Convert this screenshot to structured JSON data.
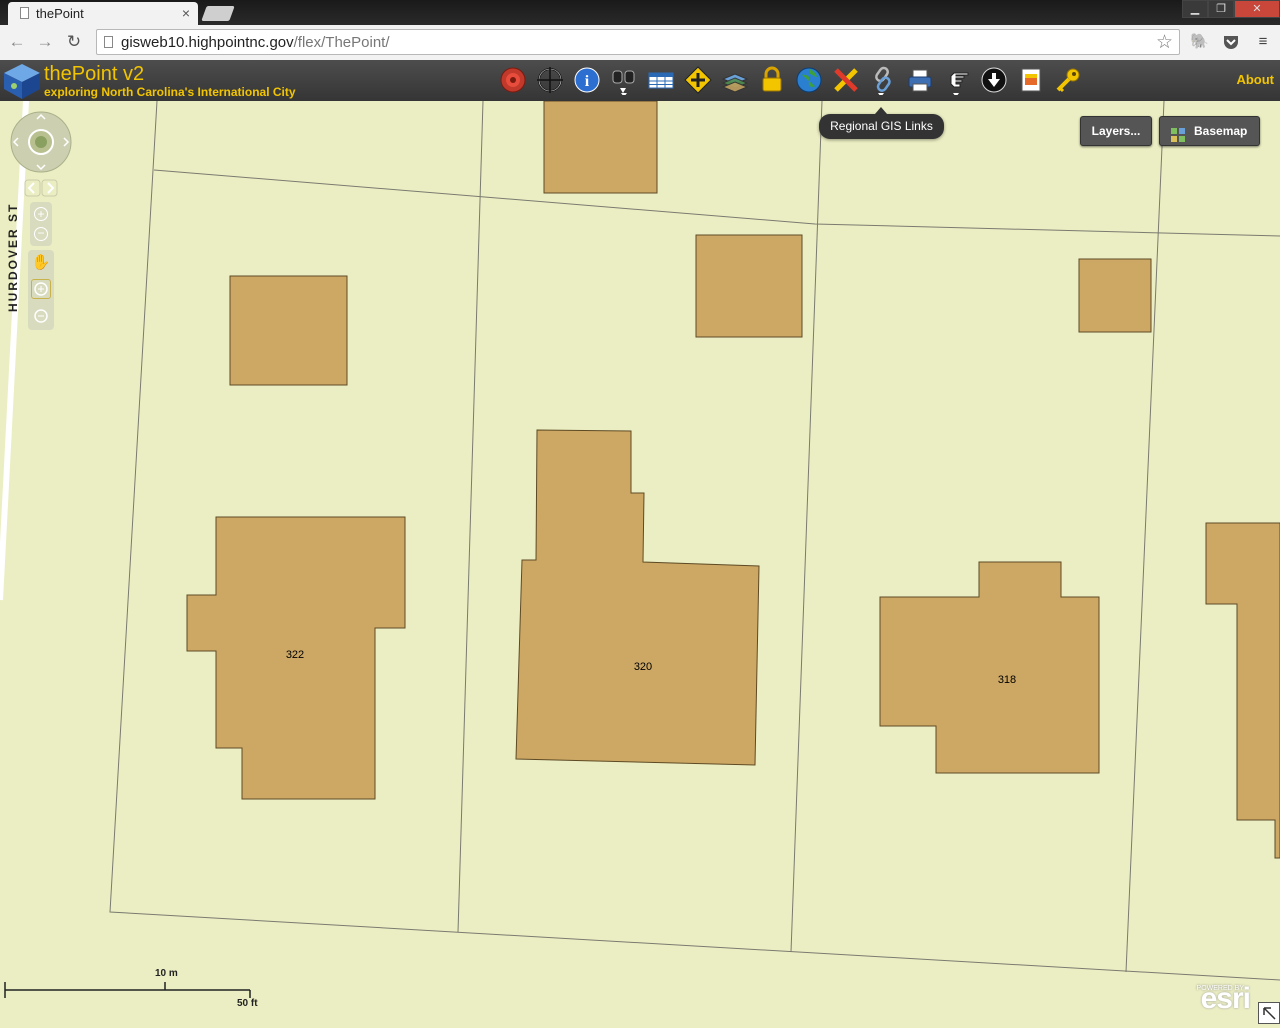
{
  "browser": {
    "tab_title": "thePoint",
    "close_tab": "×",
    "url_host": "gisweb10.highpointnc.gov",
    "url_path": "/flex/ThePoint/"
  },
  "app": {
    "title": "thePoint v2",
    "subtitle": "exploring North Carolina's International City",
    "about": "About",
    "tooltip": "Regional GIS Links",
    "tools": [
      "target-icon",
      "crosshair-icon",
      "info-icon",
      "binoculars-icon",
      "table-icon",
      "add-point-icon",
      "layers-stack-icon",
      "lock-icon",
      "globe-icon",
      "draw-tools-icon",
      "link-icon",
      "print-icon",
      "hand-pointer-icon",
      "download-icon",
      "document-icon",
      "key-icon"
    ]
  },
  "map": {
    "layers_button": "Layers...",
    "basemap_button": "Basemap",
    "street_label": "HURDOVER ST",
    "buildings": [
      "322",
      "320",
      "318"
    ],
    "scale_metric": "10 m",
    "scale_imperial": "50 ft",
    "powered_by": "POWERED BY",
    "esri": "esri"
  },
  "colors": {
    "map_background": "#ebeec2",
    "building_fill": "#cda864",
    "accent": "#f2c500"
  }
}
